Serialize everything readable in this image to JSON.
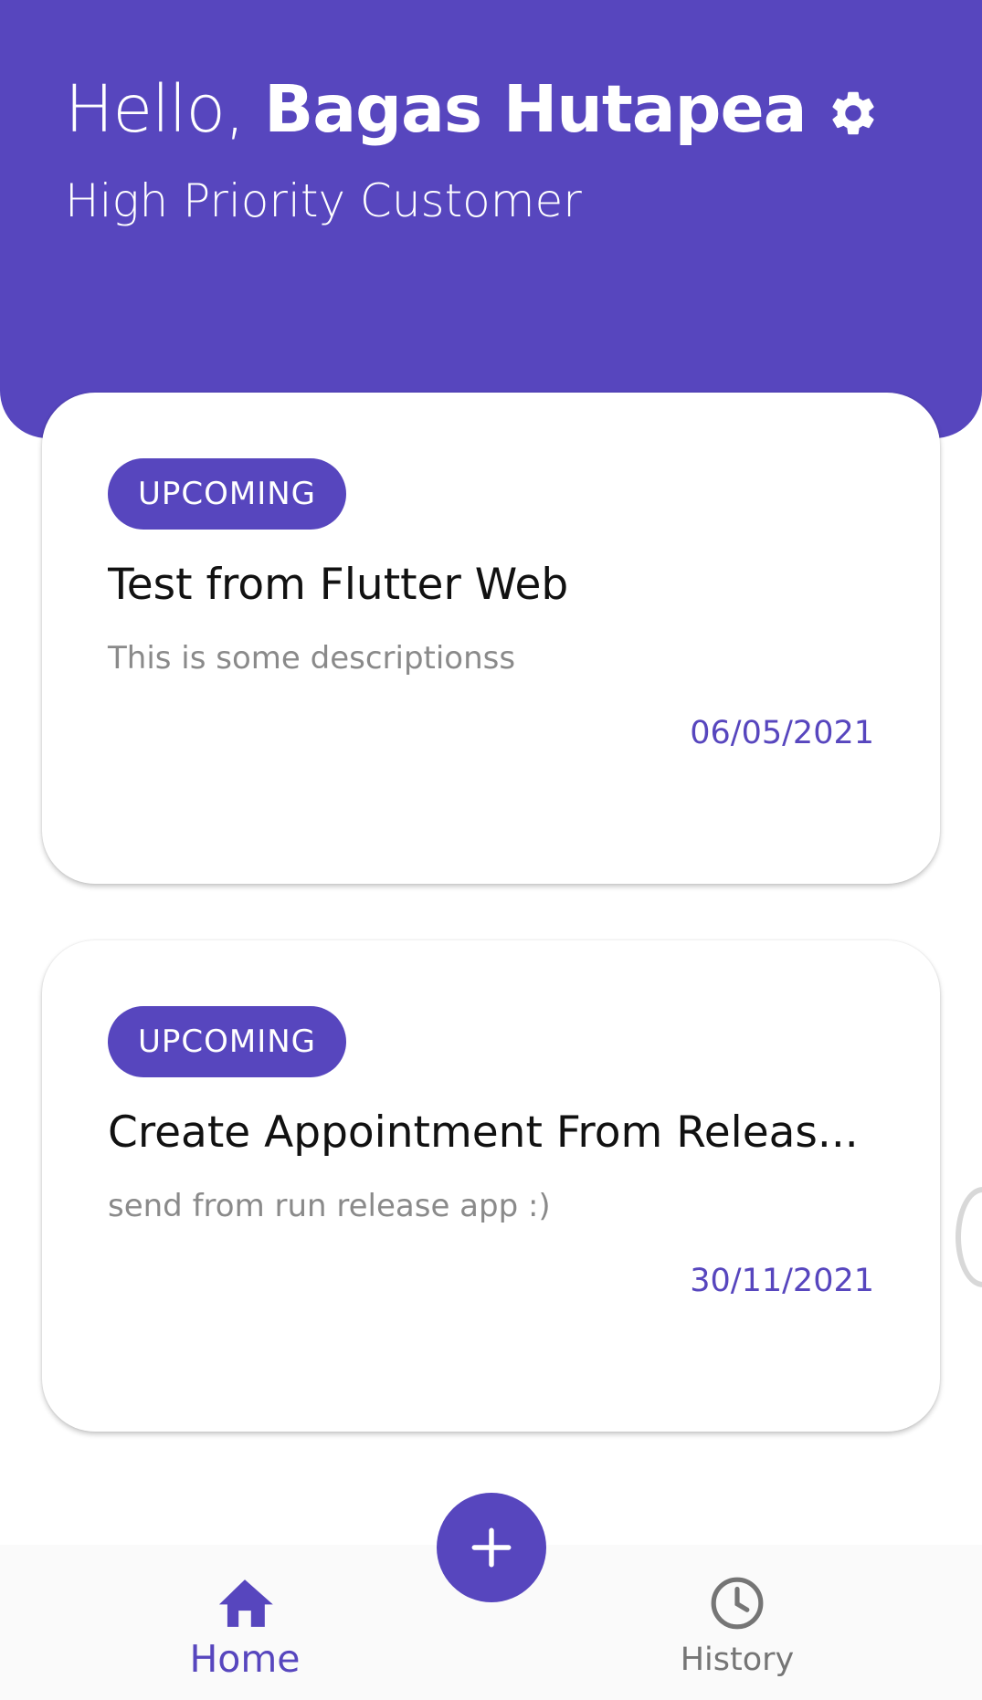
{
  "header": {
    "greeting_prefix": "Hello, ",
    "user_name": "Bagas Hutapea",
    "subtitle": "High Priority Customer",
    "settings_icon": "gear-icon"
  },
  "appointments": [
    {
      "status": "UPCOMING",
      "title": "Test from Flutter Web",
      "description": "This is some descriptionss",
      "date": "06/05/2021"
    },
    {
      "status": "UPCOMING",
      "title": "Create Appointment From Releas...",
      "description": "send from run release app :)",
      "date": "30/11/2021"
    }
  ],
  "fab": {
    "icon": "plus-icon"
  },
  "bottom_nav": {
    "home_label": "Home",
    "history_label": "History",
    "home_icon": "home-icon",
    "history_icon": "clock-icon"
  },
  "colors": {
    "primary": "#5746BE",
    "description_text": "#8A8A8A",
    "inactive_nav": "#757575",
    "nav_background": "#FAFAFA"
  }
}
